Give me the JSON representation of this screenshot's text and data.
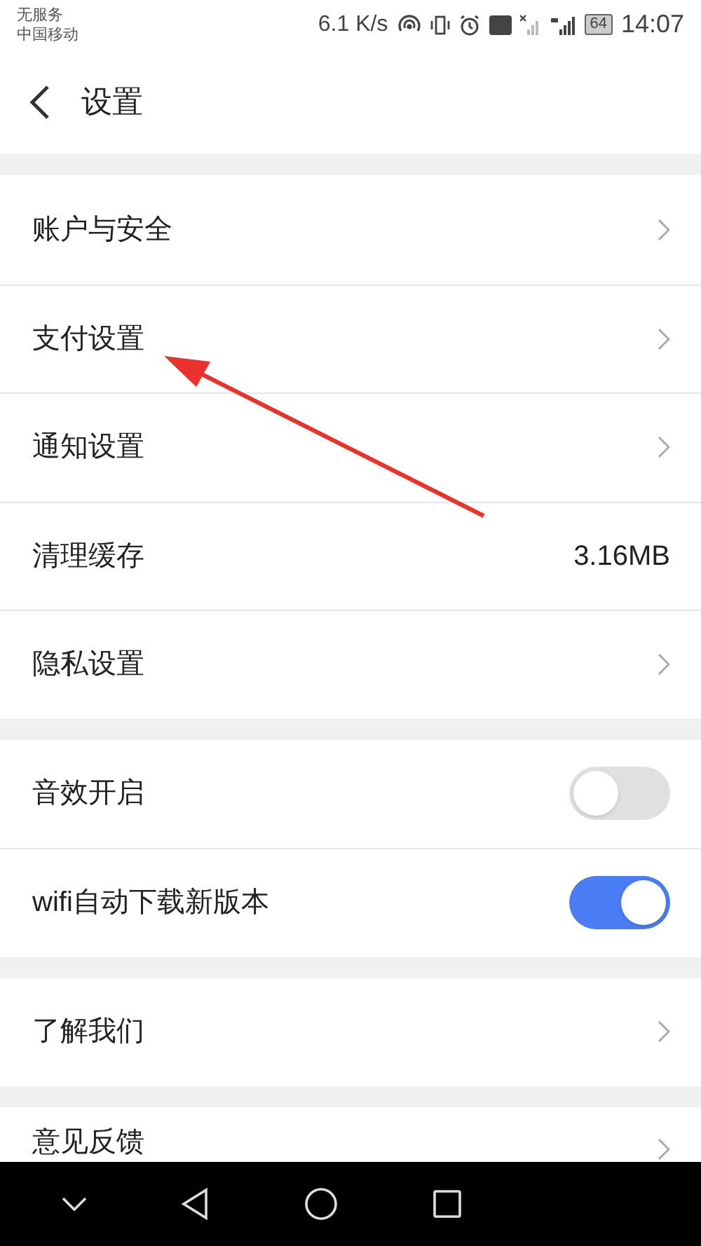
{
  "status_bar": {
    "carrier_lines": [
      "无服务",
      "中国移动"
    ],
    "net_speed": "6.1 K/s",
    "battery": "64",
    "time": "14:07"
  },
  "header": {
    "title": "设置"
  },
  "groups": [
    {
      "items": [
        {
          "kind": "link",
          "label": "账户与安全"
        },
        {
          "kind": "link",
          "label": "支付设置"
        },
        {
          "kind": "link",
          "label": "通知设置"
        },
        {
          "kind": "value",
          "label": "清理缓存",
          "value": "3.16MB"
        },
        {
          "kind": "link",
          "label": "隐私设置"
        }
      ]
    },
    {
      "items": [
        {
          "kind": "toggle",
          "label": "音效开启",
          "on": false
        },
        {
          "kind": "toggle",
          "label": "wifi自动下载新版本",
          "on": true
        }
      ]
    },
    {
      "items": [
        {
          "kind": "link",
          "label": "了解我们"
        }
      ]
    },
    {
      "items": [
        {
          "kind": "link",
          "label": "意见反馈"
        }
      ]
    }
  ]
}
